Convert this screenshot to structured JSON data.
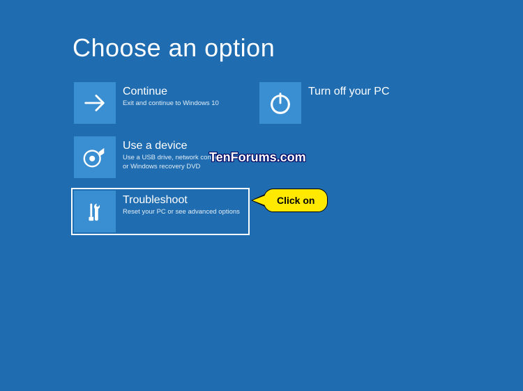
{
  "title": "Choose an option",
  "options": {
    "continue": {
      "title": "Continue",
      "desc": "Exit and continue to Windows 10"
    },
    "turnoff": {
      "title": "Turn off your PC",
      "desc": ""
    },
    "usedevice": {
      "title": "Use a device",
      "desc": "Use a USB drive, network connection, or Windows recovery DVD"
    },
    "troubleshoot": {
      "title": "Troubleshoot",
      "desc": "Reset your PC or see advanced options"
    }
  },
  "annotations": {
    "callout": "Click on",
    "watermark": "TenForums.com"
  },
  "colors": {
    "background": "#1f6cb0",
    "tile": "#3a8fd2",
    "callout_bg": "#ffe900"
  }
}
